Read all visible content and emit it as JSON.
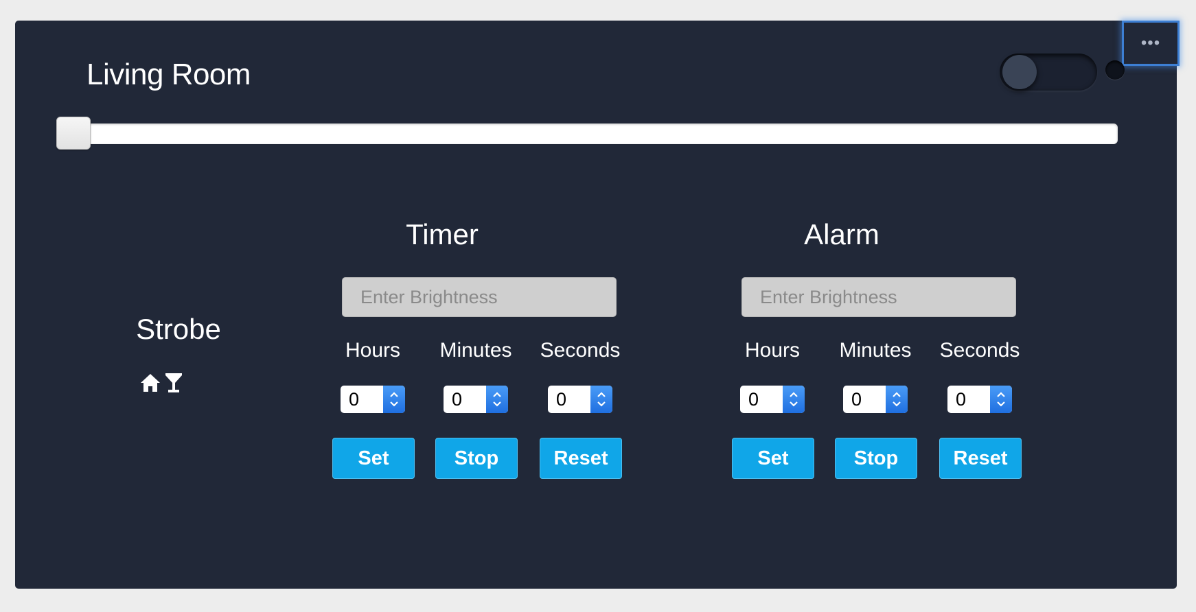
{
  "device": {
    "name": "Living Room",
    "menu_label": "•••",
    "power_on": false,
    "brightness_level": 0
  },
  "strobe": {
    "label": "Strobe",
    "icons": [
      "home-icon",
      "cocktail-icon"
    ]
  },
  "timer": {
    "title": "Timer",
    "brightness_placeholder": "Enter Brightness",
    "hours_label": "Hours",
    "minutes_label": "Minutes",
    "seconds_label": "Seconds",
    "hours_value": "0",
    "minutes_value": "0",
    "seconds_value": "0",
    "set_label": "Set",
    "stop_label": "Stop",
    "reset_label": "Reset"
  },
  "alarm": {
    "title": "Alarm",
    "brightness_placeholder": "Enter Brightness",
    "hours_label": "Hours",
    "minutes_label": "Minutes",
    "seconds_label": "Seconds",
    "hours_value": "0",
    "minutes_value": "0",
    "seconds_value": "0",
    "set_label": "Set",
    "stop_label": "Stop",
    "reset_label": "Reset"
  },
  "colors": {
    "page_background": "#ededed",
    "card_background": "#212838",
    "button_blue": "#10a6e8",
    "menu_focus_border": "#3d7fd3",
    "stepper_blue": "#1f6fe0"
  }
}
